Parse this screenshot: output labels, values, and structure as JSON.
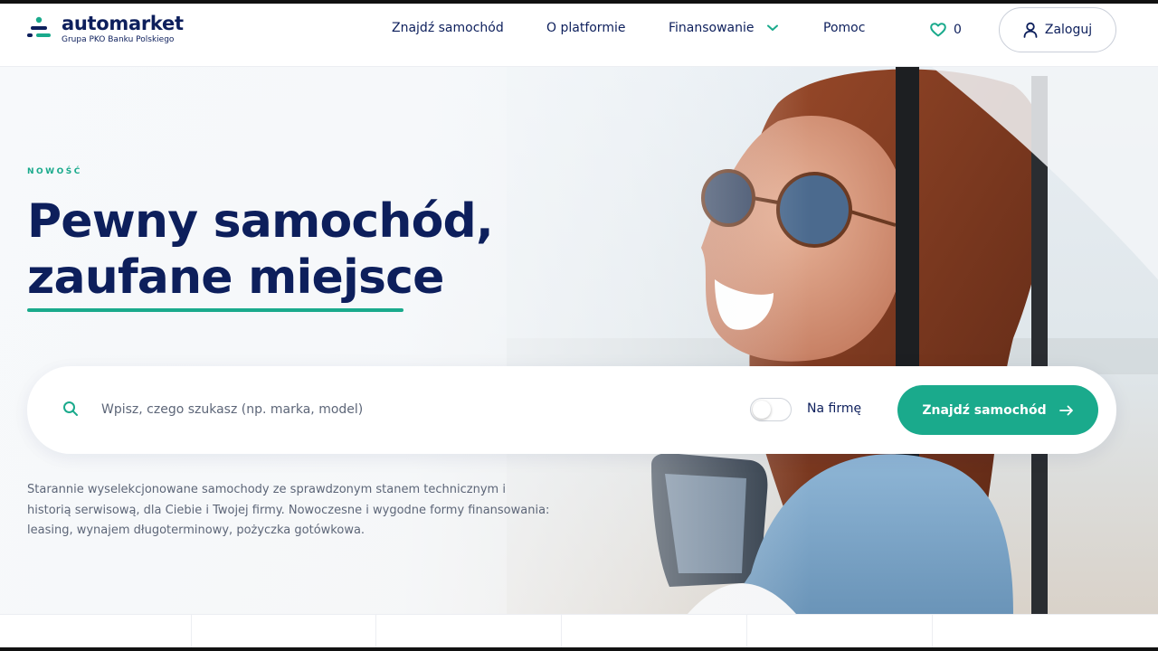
{
  "brand": {
    "name": "automarket",
    "tagline": "Grupa PKO Banku Polskiego",
    "accent": "#1aaa8c",
    "navy": "#0d1f5c"
  },
  "nav": {
    "items": [
      {
        "label": "Znajdź samochód"
      },
      {
        "label": "O platformie"
      },
      {
        "label": "Finansowanie",
        "has_dropdown": true
      },
      {
        "label": "Pomoc"
      }
    ],
    "favorites_count": "0",
    "login_label": "Zaloguj"
  },
  "hero": {
    "eyebrow": "NOWOŚĆ",
    "headline_line1": "Pewny samochód,",
    "headline_line2": "zaufane miejsce",
    "description": "Starannie wyselekcjonowane samochody ze sprawdzonym stanem technicznym i historią serwisową, dla Ciebie i Twojej firmy. Nowoczesne i wygodne formy finansowania: leasing, wynajem długoterminowy, pożyczka gotówkowa."
  },
  "search": {
    "placeholder": "Wpisz, czego szukasz (np. marka, model)",
    "value": "",
    "toggle_label": "Na firmę",
    "toggle_on": false,
    "submit_label": "Znajdź samochód"
  },
  "icons": {
    "favorites": "heart-icon",
    "login": "user-icon",
    "search": "search-icon",
    "submit": "arrow-right-icon",
    "dropdown": "chevron-down-icon"
  }
}
